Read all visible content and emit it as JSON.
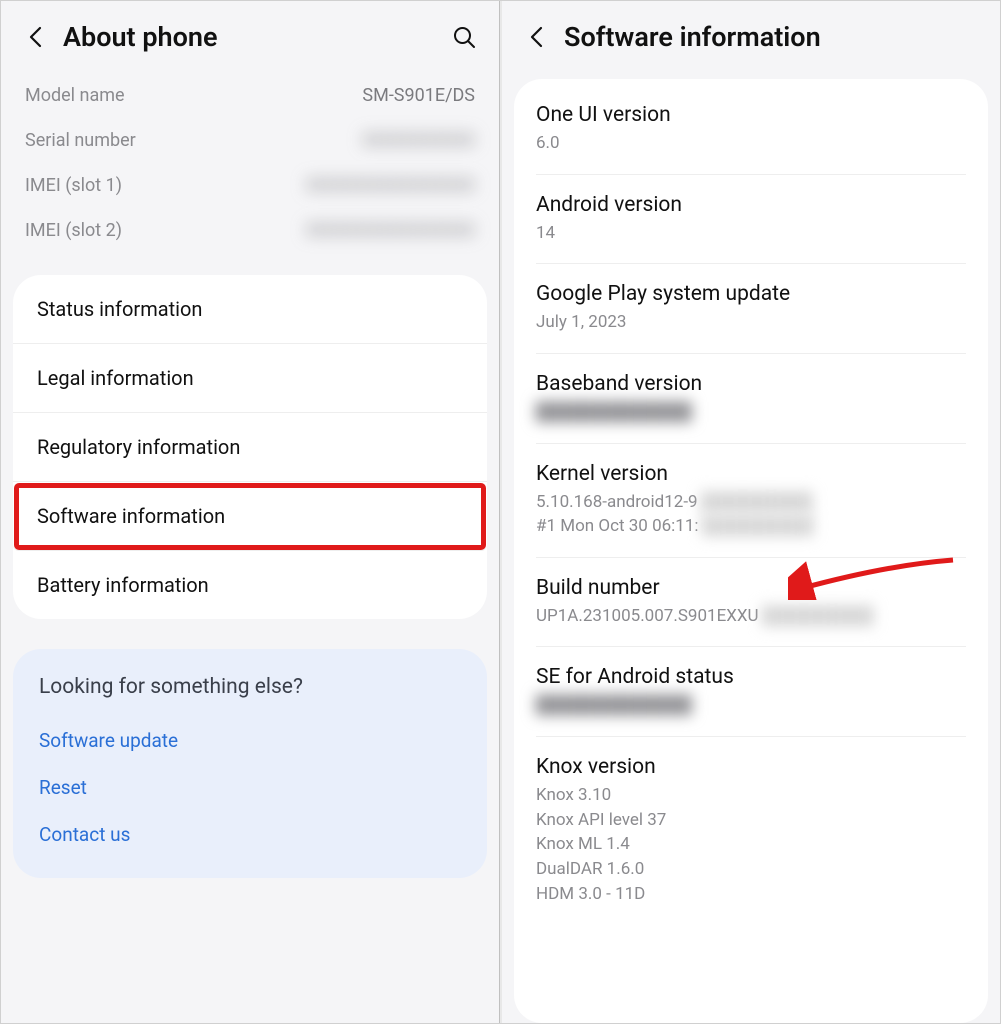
{
  "left": {
    "title": "About phone",
    "info": [
      {
        "label": "Model name",
        "value": "SM-S901E/DS",
        "blurred": false
      },
      {
        "label": "Serial number",
        "value": "XXXXXXXXXX",
        "blurred": true
      },
      {
        "label": "IMEI (slot 1)",
        "value": "XXXXXXXXXXXXXXX",
        "blurred": true
      },
      {
        "label": "IMEI (slot 2)",
        "value": "XXXXXXXXXXXXXXX",
        "blurred": true
      }
    ],
    "menu": [
      {
        "label": "Status information",
        "highlight": false
      },
      {
        "label": "Legal information",
        "highlight": false
      },
      {
        "label": "Regulatory information",
        "highlight": false
      },
      {
        "label": "Software information",
        "highlight": true
      },
      {
        "label": "Battery information",
        "highlight": false
      }
    ],
    "suggest": {
      "title": "Looking for something else?",
      "links": [
        "Software update",
        "Reset",
        "Contact us"
      ]
    }
  },
  "right": {
    "title": "Software information",
    "items": [
      {
        "label": "One UI version",
        "value": "6.0"
      },
      {
        "label": "Android version",
        "value": "14"
      },
      {
        "label": "Google Play system update",
        "value": "July 1, 2023"
      },
      {
        "label": "Baseband version",
        "value": "",
        "blurred": true
      },
      {
        "label": "Kernel version",
        "value": "5.10.168-android12-9\n#1 Mon Oct 30 06:11:",
        "partial_blur": true
      },
      {
        "label": "Build number",
        "value": "UP1A.231005.007.S901EXXU",
        "partial_blur": true,
        "arrow": true
      },
      {
        "label": "SE for Android status",
        "value": "",
        "blurred": true
      },
      {
        "label": "Knox version",
        "value": "Knox 3.10\nKnox API level 37\nKnox ML 1.4\nDualDAR 1.6.0\nHDM 3.0 - 11D"
      }
    ]
  }
}
